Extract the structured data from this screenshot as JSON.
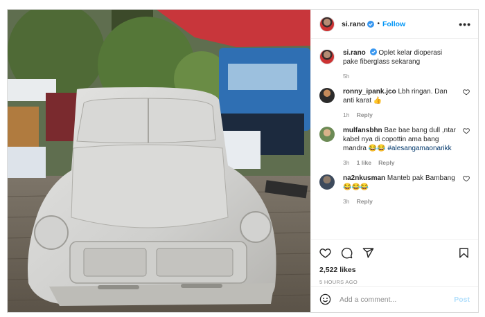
{
  "post": {
    "username": "si.rano",
    "follow_label": "Follow",
    "dot": "•",
    "more_label": "•••",
    "caption": {
      "username": "si.rano",
      "text": "Oplet kelar dioperasi pake fiberglass sekarang",
      "time": "5h"
    },
    "comments": [
      {
        "username": "ronny_ipank.jco",
        "text": "Lbh ringan. Dan anti karat 👍",
        "tag": "",
        "time": "1h",
        "likes": "",
        "reply": "Reply"
      },
      {
        "username": "mulfansbhn",
        "text": "Bae bae bang dull ,ntar kabel nya di copottin ama bang mandra 😂😂 ",
        "tag": "#alesangamaonarikk",
        "time": "3h",
        "likes": "1 like",
        "reply": "Reply"
      },
      {
        "username": "na2nkusman",
        "text": "Manteb pak Bambang 😂😂😂",
        "tag": "",
        "time": "3h",
        "likes": "",
        "reply": "Reply"
      }
    ],
    "likes": "2,522 likes",
    "timestamp": "5 HOURS AGO",
    "comment_placeholder": "Add a comment...",
    "post_label": "Post"
  },
  "colors": {
    "link": "#0095f6",
    "muted": "#8e8e8e",
    "post_disabled": "#b2dffc"
  }
}
